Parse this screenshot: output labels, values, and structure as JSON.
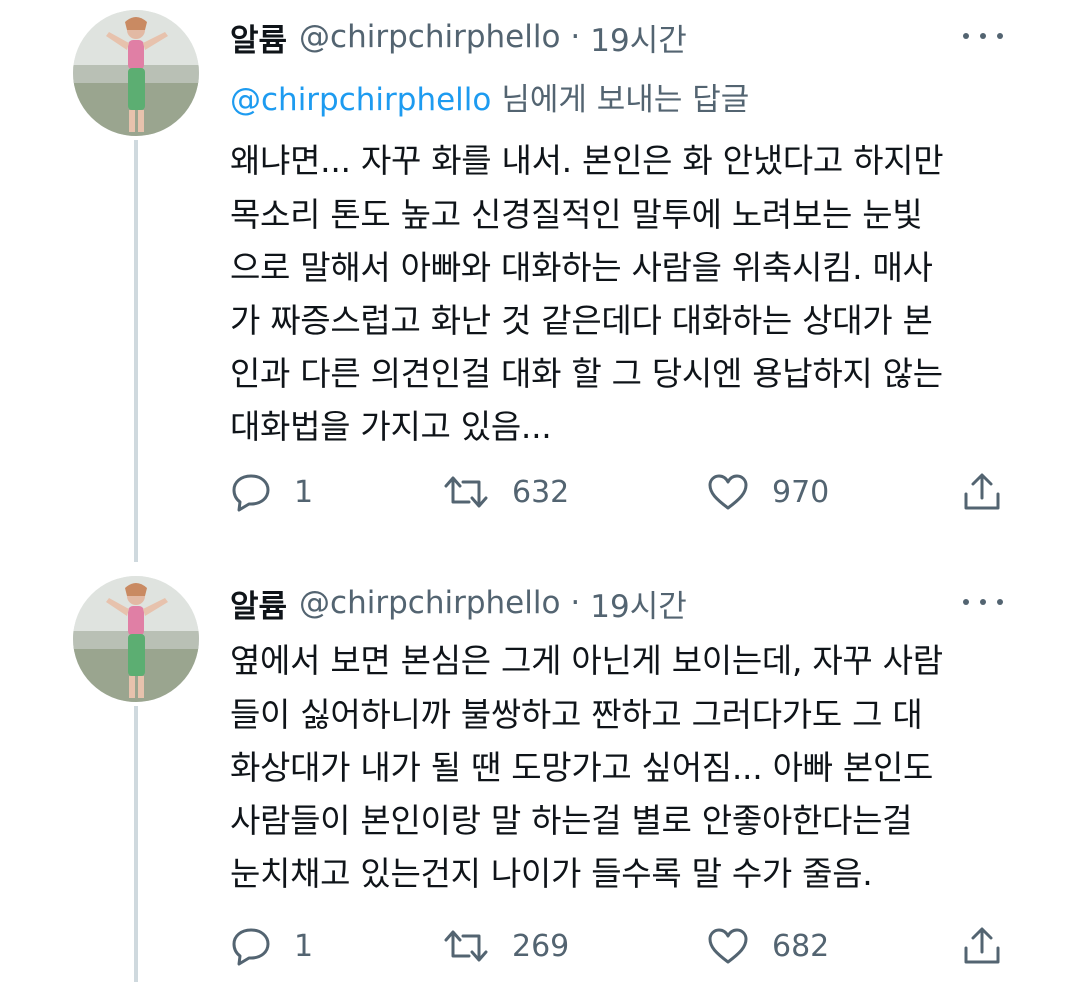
{
  "tweets": [
    {
      "display_name": "알륨",
      "handle": "@chirpchirphello",
      "separator": "·",
      "time": "19시간",
      "reply_to_handle": "@chirpchirphello",
      "reply_to_suffix": "님에게 보내는 답글",
      "lines": [
        "왜냐면... 자꾸 화를 내서. 본인은 화 안냈다고 하지만",
        "목소리 톤도 높고 신경질적인 말투에 노려보는 눈빛",
        "으로 말해서 아빠와 대화하는 사람을 위축시킴. 매사",
        "가 짜증스럽고 화난 것 같은데다 대화하는 상대가 본",
        "인과 다른 의견인걸 대화 할 그 당시엔 용납하지 않는",
        "대화법을 가지고 있음..."
      ],
      "replies": "1",
      "retweets": "632",
      "likes": "970",
      "icons": [
        "reply-icon",
        "retweet-icon",
        "like-icon",
        "share-icon",
        "more-icon"
      ]
    },
    {
      "display_name": "알륨",
      "handle": "@chirpchirphello",
      "separator": "·",
      "time": "19시간",
      "lines": [
        "옆에서 보면 본심은 그게 아닌게 보이는데, 자꾸 사람",
        "들이 싫어하니까 불쌍하고 짠하고 그러다가도 그 대",
        "화상대가 내가 될 땐 도망가고 싶어짐... 아빠 본인도",
        "사람들이 본인이랑 말 하는걸 별로 안좋아한다는걸",
        "눈치채고 있는건지 나이가 들수록 말 수가 줄음."
      ],
      "replies": "1",
      "retweets": "269",
      "likes": "682",
      "icons": [
        "reply-icon",
        "retweet-icon",
        "like-icon",
        "share-icon",
        "more-icon"
      ]
    }
  ],
  "colors": {
    "text": "#0f1419",
    "secondary": "#536471",
    "link": "#1d9bf0",
    "thread_line": "#cfd9de"
  }
}
